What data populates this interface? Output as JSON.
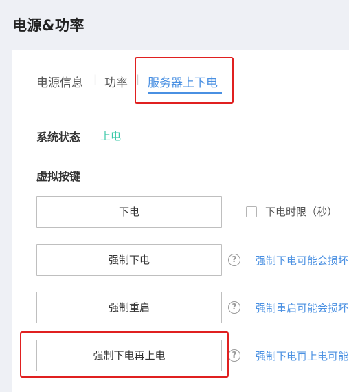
{
  "page": {
    "title": "电源&功率"
  },
  "tabs": [
    {
      "label": "电源信息",
      "active": false
    },
    {
      "label": "功率",
      "active": false
    },
    {
      "label": "服务器上下电",
      "active": true
    }
  ],
  "tab_separator": "|",
  "system_status": {
    "label": "系统状态",
    "value": "上电",
    "value_color": "#3cc8a8"
  },
  "virtual_keys": {
    "label": "虚拟按键",
    "power_off": {
      "label": "下电",
      "checkbox_label": "下电时限（秒）"
    },
    "force_power_off": {
      "label": "强制下电",
      "warning": "强制下电可能会损坏"
    },
    "force_restart": {
      "label": "强制重启",
      "warning": "强制重启可能会损坏"
    },
    "force_power_cycle": {
      "label": "强制下电再上电",
      "warning": "强制下电再上电可能"
    }
  },
  "help_glyph": "?",
  "colors": {
    "accent": "#4a90e2",
    "highlight_box": "#e02020",
    "status_on": "#3cc8a8"
  }
}
